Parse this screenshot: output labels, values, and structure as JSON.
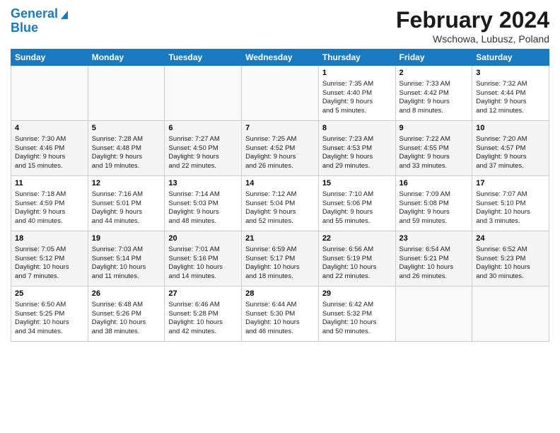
{
  "header": {
    "logo_line1": "General",
    "logo_line2": "Blue",
    "month_year": "February 2024",
    "location": "Wschowa, Lubusz, Poland"
  },
  "days_of_week": [
    "Sunday",
    "Monday",
    "Tuesday",
    "Wednesday",
    "Thursday",
    "Friday",
    "Saturday"
  ],
  "weeks": [
    [
      {
        "day": "",
        "info": ""
      },
      {
        "day": "",
        "info": ""
      },
      {
        "day": "",
        "info": ""
      },
      {
        "day": "",
        "info": ""
      },
      {
        "day": "1",
        "info": "Sunrise: 7:35 AM\nSunset: 4:40 PM\nDaylight: 9 hours\nand 5 minutes."
      },
      {
        "day": "2",
        "info": "Sunrise: 7:33 AM\nSunset: 4:42 PM\nDaylight: 9 hours\nand 8 minutes."
      },
      {
        "day": "3",
        "info": "Sunrise: 7:32 AM\nSunset: 4:44 PM\nDaylight: 9 hours\nand 12 minutes."
      }
    ],
    [
      {
        "day": "4",
        "info": "Sunrise: 7:30 AM\nSunset: 4:46 PM\nDaylight: 9 hours\nand 15 minutes."
      },
      {
        "day": "5",
        "info": "Sunrise: 7:28 AM\nSunset: 4:48 PM\nDaylight: 9 hours\nand 19 minutes."
      },
      {
        "day": "6",
        "info": "Sunrise: 7:27 AM\nSunset: 4:50 PM\nDaylight: 9 hours\nand 22 minutes."
      },
      {
        "day": "7",
        "info": "Sunrise: 7:25 AM\nSunset: 4:52 PM\nDaylight: 9 hours\nand 26 minutes."
      },
      {
        "day": "8",
        "info": "Sunrise: 7:23 AM\nSunset: 4:53 PM\nDaylight: 9 hours\nand 29 minutes."
      },
      {
        "day": "9",
        "info": "Sunrise: 7:22 AM\nSunset: 4:55 PM\nDaylight: 9 hours\nand 33 minutes."
      },
      {
        "day": "10",
        "info": "Sunrise: 7:20 AM\nSunset: 4:57 PM\nDaylight: 9 hours\nand 37 minutes."
      }
    ],
    [
      {
        "day": "11",
        "info": "Sunrise: 7:18 AM\nSunset: 4:59 PM\nDaylight: 9 hours\nand 40 minutes."
      },
      {
        "day": "12",
        "info": "Sunrise: 7:16 AM\nSunset: 5:01 PM\nDaylight: 9 hours\nand 44 minutes."
      },
      {
        "day": "13",
        "info": "Sunrise: 7:14 AM\nSunset: 5:03 PM\nDaylight: 9 hours\nand 48 minutes."
      },
      {
        "day": "14",
        "info": "Sunrise: 7:12 AM\nSunset: 5:04 PM\nDaylight: 9 hours\nand 52 minutes."
      },
      {
        "day": "15",
        "info": "Sunrise: 7:10 AM\nSunset: 5:06 PM\nDaylight: 9 hours\nand 55 minutes."
      },
      {
        "day": "16",
        "info": "Sunrise: 7:09 AM\nSunset: 5:08 PM\nDaylight: 9 hours\nand 59 minutes."
      },
      {
        "day": "17",
        "info": "Sunrise: 7:07 AM\nSunset: 5:10 PM\nDaylight: 10 hours\nand 3 minutes."
      }
    ],
    [
      {
        "day": "18",
        "info": "Sunrise: 7:05 AM\nSunset: 5:12 PM\nDaylight: 10 hours\nand 7 minutes."
      },
      {
        "day": "19",
        "info": "Sunrise: 7:03 AM\nSunset: 5:14 PM\nDaylight: 10 hours\nand 11 minutes."
      },
      {
        "day": "20",
        "info": "Sunrise: 7:01 AM\nSunset: 5:16 PM\nDaylight: 10 hours\nand 14 minutes."
      },
      {
        "day": "21",
        "info": "Sunrise: 6:59 AM\nSunset: 5:17 PM\nDaylight: 10 hours\nand 18 minutes."
      },
      {
        "day": "22",
        "info": "Sunrise: 6:56 AM\nSunset: 5:19 PM\nDaylight: 10 hours\nand 22 minutes."
      },
      {
        "day": "23",
        "info": "Sunrise: 6:54 AM\nSunset: 5:21 PM\nDaylight: 10 hours\nand 26 minutes."
      },
      {
        "day": "24",
        "info": "Sunrise: 6:52 AM\nSunset: 5:23 PM\nDaylight: 10 hours\nand 30 minutes."
      }
    ],
    [
      {
        "day": "25",
        "info": "Sunrise: 6:50 AM\nSunset: 5:25 PM\nDaylight: 10 hours\nand 34 minutes."
      },
      {
        "day": "26",
        "info": "Sunrise: 6:48 AM\nSunset: 5:26 PM\nDaylight: 10 hours\nand 38 minutes."
      },
      {
        "day": "27",
        "info": "Sunrise: 6:46 AM\nSunset: 5:28 PM\nDaylight: 10 hours\nand 42 minutes."
      },
      {
        "day": "28",
        "info": "Sunrise: 6:44 AM\nSunset: 5:30 PM\nDaylight: 10 hours\nand 46 minutes."
      },
      {
        "day": "29",
        "info": "Sunrise: 6:42 AM\nSunset: 5:32 PM\nDaylight: 10 hours\nand 50 minutes."
      },
      {
        "day": "",
        "info": ""
      },
      {
        "day": "",
        "info": ""
      }
    ]
  ]
}
